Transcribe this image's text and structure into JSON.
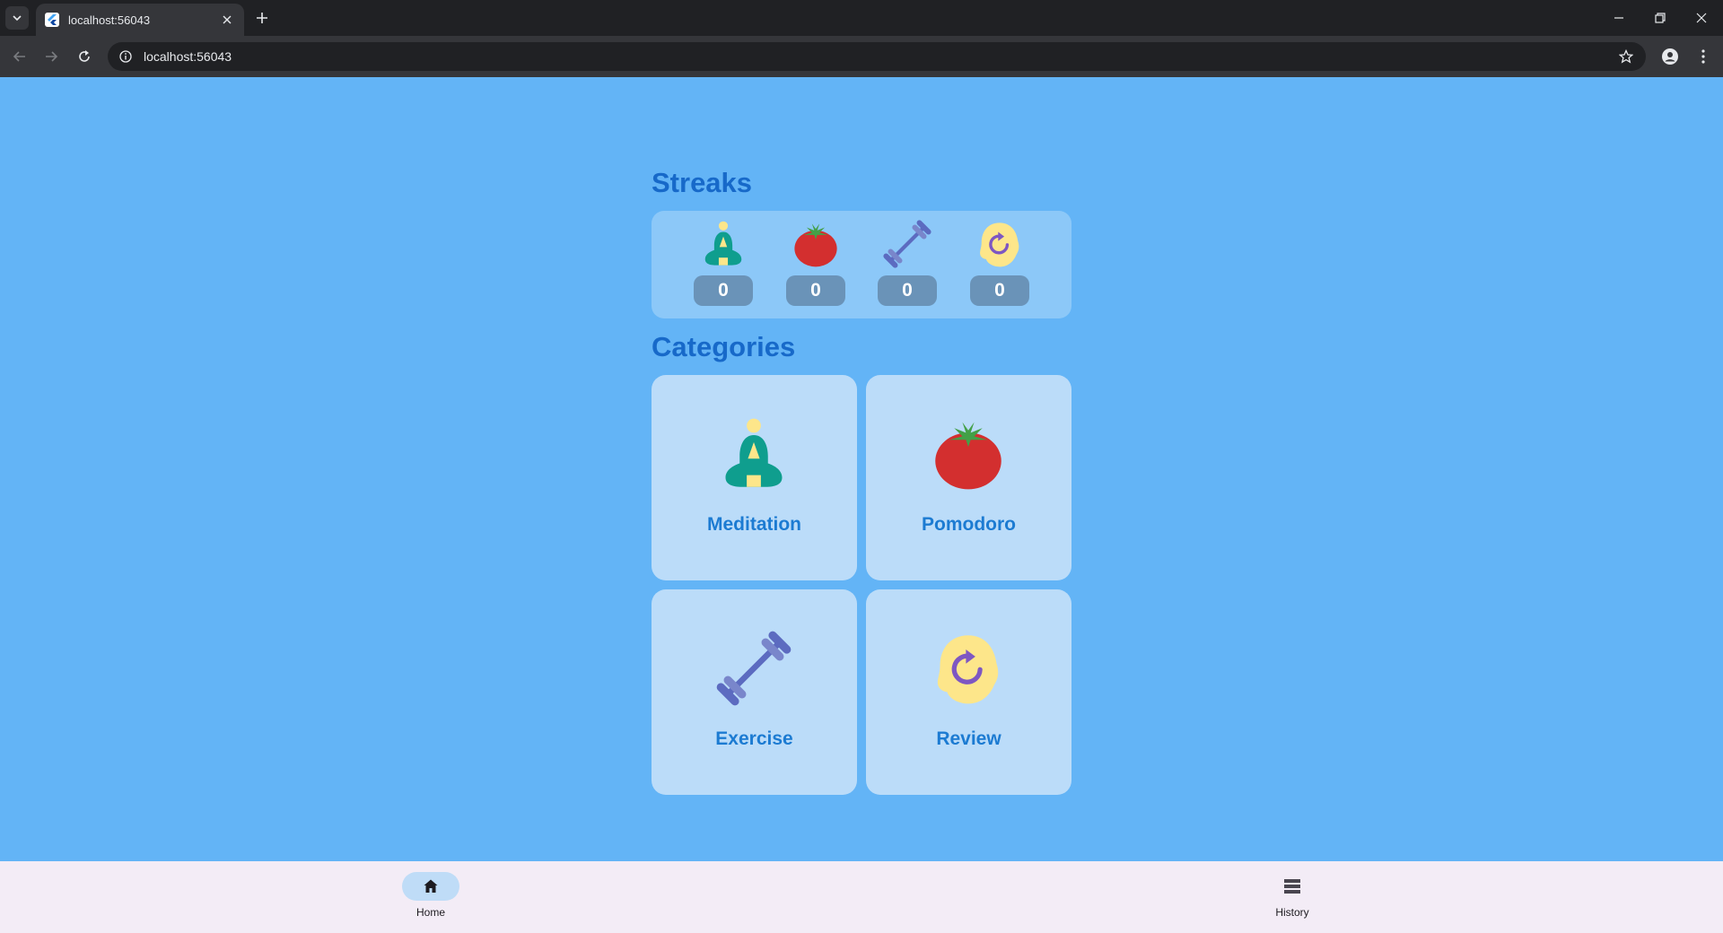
{
  "browser": {
    "tab_title": "localhost:56043",
    "url": "localhost:56043"
  },
  "streaks": {
    "title": "Streaks",
    "items": [
      {
        "icon": "meditation-icon",
        "count": "0"
      },
      {
        "icon": "tomato-icon",
        "count": "0"
      },
      {
        "icon": "dumbbell-icon",
        "count": "0"
      },
      {
        "icon": "review-icon",
        "count": "0"
      }
    ]
  },
  "categories": {
    "title": "Categories",
    "items": [
      {
        "label": "Meditation",
        "icon": "meditation-icon"
      },
      {
        "label": "Pomodoro",
        "icon": "tomato-icon"
      },
      {
        "label": "Exercise",
        "icon": "dumbbell-icon"
      },
      {
        "label": "Review",
        "icon": "review-icon"
      }
    ]
  },
  "bottom_nav": {
    "items": [
      {
        "label": "Home",
        "icon": "home-icon",
        "active": true
      },
      {
        "label": "History",
        "icon": "history-icon",
        "active": false
      }
    ]
  },
  "colors": {
    "background": "#63b4f6",
    "title": "#1769c9",
    "card": "#bbdcf9",
    "streak_card": "#8cc8f8",
    "streak_badge": "#6a93b8",
    "category_label": "#1c7bd2",
    "bottom_nav": "#f3ecf6"
  }
}
